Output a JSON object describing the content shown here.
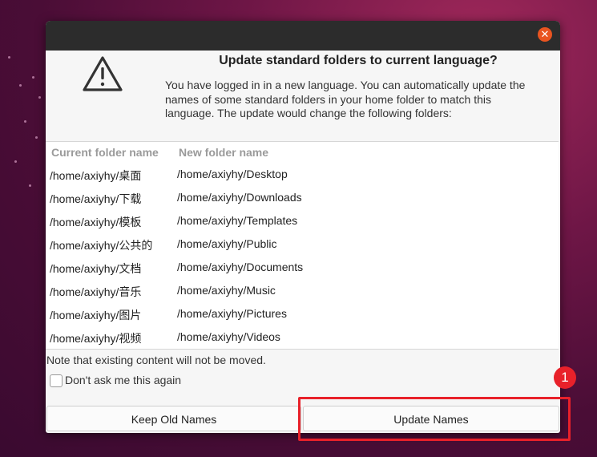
{
  "dialog": {
    "title": "Update standard folders to current language?",
    "description": "You have logged in in a new language. You can automatically update the names of some standard folders in your home folder to match this language. The update would change the following folders:",
    "close_icon": "✕"
  },
  "table": {
    "headers": [
      "Current folder name",
      "New folder name"
    ],
    "rows": [
      {
        "current": "/home/axiyhy/桌面",
        "new": "/home/axiyhy/Desktop"
      },
      {
        "current": "/home/axiyhy/下载",
        "new": "/home/axiyhy/Downloads"
      },
      {
        "current": "/home/axiyhy/模板",
        "new": "/home/axiyhy/Templates"
      },
      {
        "current": "/home/axiyhy/公共的",
        "new": "/home/axiyhy/Public"
      },
      {
        "current": "/home/axiyhy/文档",
        "new": "/home/axiyhy/Documents"
      },
      {
        "current": "/home/axiyhy/音乐",
        "new": "/home/axiyhy/Music"
      },
      {
        "current": "/home/axiyhy/图片",
        "new": "/home/axiyhy/Pictures"
      },
      {
        "current": "/home/axiyhy/视频",
        "new": "/home/axiyhy/Videos"
      }
    ]
  },
  "note": "Note that existing content will not be moved.",
  "checkbox": {
    "label": "Don't ask me this again",
    "checked": false
  },
  "buttons": {
    "keep_label": "Keep Old Names",
    "update_label": "Update Names"
  },
  "annotation": {
    "step_number": "1",
    "color": "#e8212a"
  },
  "colors": {
    "accent": "#e95420",
    "titlebar": "#2c2c2c"
  }
}
